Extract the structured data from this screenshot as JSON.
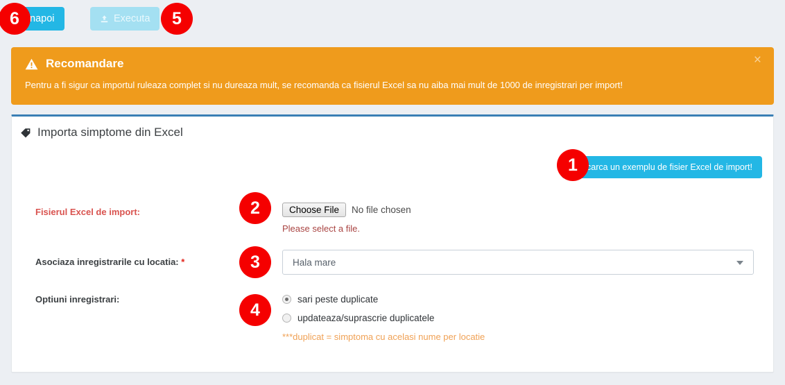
{
  "toolbar": {
    "back_label": "Inapoi",
    "back_icon": "arrow-left-icon",
    "execute_label": "Executa",
    "execute_icon": "upload-icon"
  },
  "badges": {
    "b1": "1",
    "b2": "2",
    "b3": "3",
    "b4": "4",
    "b5": "5",
    "b6": "6"
  },
  "alert": {
    "icon": "warning-triangle-icon",
    "title": "Recomandare",
    "message": "Pentru a fi sigur ca importul ruleaza complet si nu dureaza mult, se recomanda ca fisierul Excel sa nu aiba mai mult de 1000 de inregistrari per import!",
    "close_label": "×",
    "background_color": "#ef9b1c"
  },
  "panel": {
    "icon": "tag-icon",
    "title": "Importa simptome din Excel",
    "accent_color": "#3a7fb5"
  },
  "download": {
    "label": "Descarca un exemplu de fisier Excel de import!",
    "color": "#23b7e5"
  },
  "form": {
    "file_row": {
      "label": "Fisierul Excel de import:",
      "button_label": "Choose File",
      "file_status": "No file chosen",
      "error": "Please select a file."
    },
    "location_row": {
      "label": "Asociaza inregistrarile cu locatia:",
      "required_mark": "*",
      "value": "Hala mare",
      "caret_icon": "chevron-down-icon"
    },
    "options_row": {
      "label": "Optiuni inregistrari:",
      "option_1": "sari peste duplicate",
      "option_2": "updateaza/suprascrie duplicatele",
      "note": "***duplicat = simptoma cu acelasi nume per locatie",
      "note_color": "#f0a155"
    }
  }
}
